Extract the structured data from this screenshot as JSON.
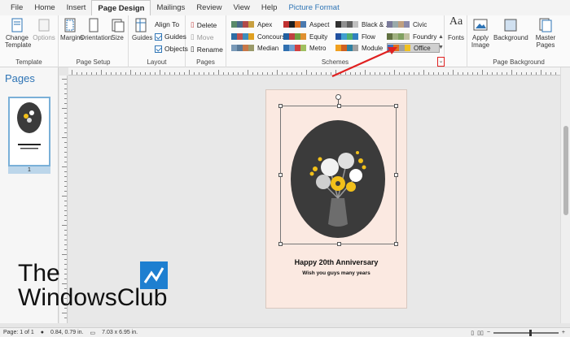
{
  "menu": {
    "tabs": [
      "File",
      "Home",
      "Insert",
      "Page Design",
      "Mailings",
      "Review",
      "View",
      "Help",
      "Picture Format"
    ],
    "active_tab": "Page Design"
  },
  "ribbon": {
    "template": {
      "change_label": "Change\nTemplate",
      "options_label": "Options",
      "group_label": "Template"
    },
    "page_setup": {
      "margins_label": "Margins",
      "orientation_label": "Orientation",
      "size_label": "Size",
      "group_label": "Page Setup"
    },
    "layout": {
      "guides_label": "Guides",
      "align_to_label": "Align To",
      "guides_check_label": "Guides",
      "objects_check_label": "Objects",
      "group_label": "Layout"
    },
    "pages": {
      "delete_label": "Delete",
      "move_label": "Move",
      "rename_label": "Rename",
      "group_label": "Pages"
    },
    "schemes": {
      "group_label": "Schemes",
      "items": [
        {
          "name": "Apex",
          "colors": [
            "#5a8a6a",
            "#4a6a8a",
            "#b04a4a",
            "#c8a040"
          ]
        },
        {
          "name": "Concourse",
          "colors": [
            "#2e6da4",
            "#c0504d",
            "#3c8dbc",
            "#e0a020"
          ]
        },
        {
          "name": "Median",
          "colors": [
            "#7a9ab8",
            "#5a7a98",
            "#c87848",
            "#9a9a6a"
          ]
        },
        {
          "name": "Aspect",
          "colors": [
            "#c03030",
            "#202020",
            "#e07020",
            "#4a7ab0"
          ]
        },
        {
          "name": "Equity",
          "colors": [
            "#2060a0",
            "#c04040",
            "#70a040",
            "#e09030"
          ]
        },
        {
          "name": "Metro",
          "colors": [
            "#3070b0",
            "#70a0d0",
            "#d04040",
            "#a0c060"
          ]
        },
        {
          "name": "Black & ...",
          "colors": [
            "#303030",
            "#909090",
            "#606060",
            "#c0c0c0"
          ]
        },
        {
          "name": "Flow",
          "colors": [
            "#2050a0",
            "#40a0d0",
            "#50b070",
            "#3080c0"
          ]
        },
        {
          "name": "Module",
          "colors": [
            "#f0a020",
            "#d06020",
            "#3080a0",
            "#a0a0a0"
          ]
        },
        {
          "name": "Civic",
          "colors": [
            "#7a7a9a",
            "#9aaaaa",
            "#c0a080",
            "#8a8aaa"
          ]
        },
        {
          "name": "Foundry",
          "colors": [
            "#607040",
            "#a0b080",
            "#80a060",
            "#c0c0a0"
          ]
        },
        {
          "name": "Office",
          "colors": [
            "#4070c0",
            "#e07020",
            "#a0a0a0",
            "#f0c020"
          ]
        }
      ],
      "selected": "Office"
    },
    "fonts_label": "Fonts",
    "page_background": {
      "apply_image_label": "Apply\nImage",
      "background_label": "Background",
      "master_pages_label": "Master\nPages",
      "group_label": "Page Background"
    }
  },
  "pages_pane": {
    "title": "Pages",
    "thumbnail_number": "1"
  },
  "card": {
    "title": "Happy 20th Anniversary",
    "subtitle": "Wish you guys many years"
  },
  "status": {
    "page": "Page: 1 of 1",
    "position": "0.84, 0.79 in.",
    "size": "7.03 x 6.95 in."
  },
  "watermark": {
    "line1": "The",
    "line2": "WindowsClub"
  }
}
